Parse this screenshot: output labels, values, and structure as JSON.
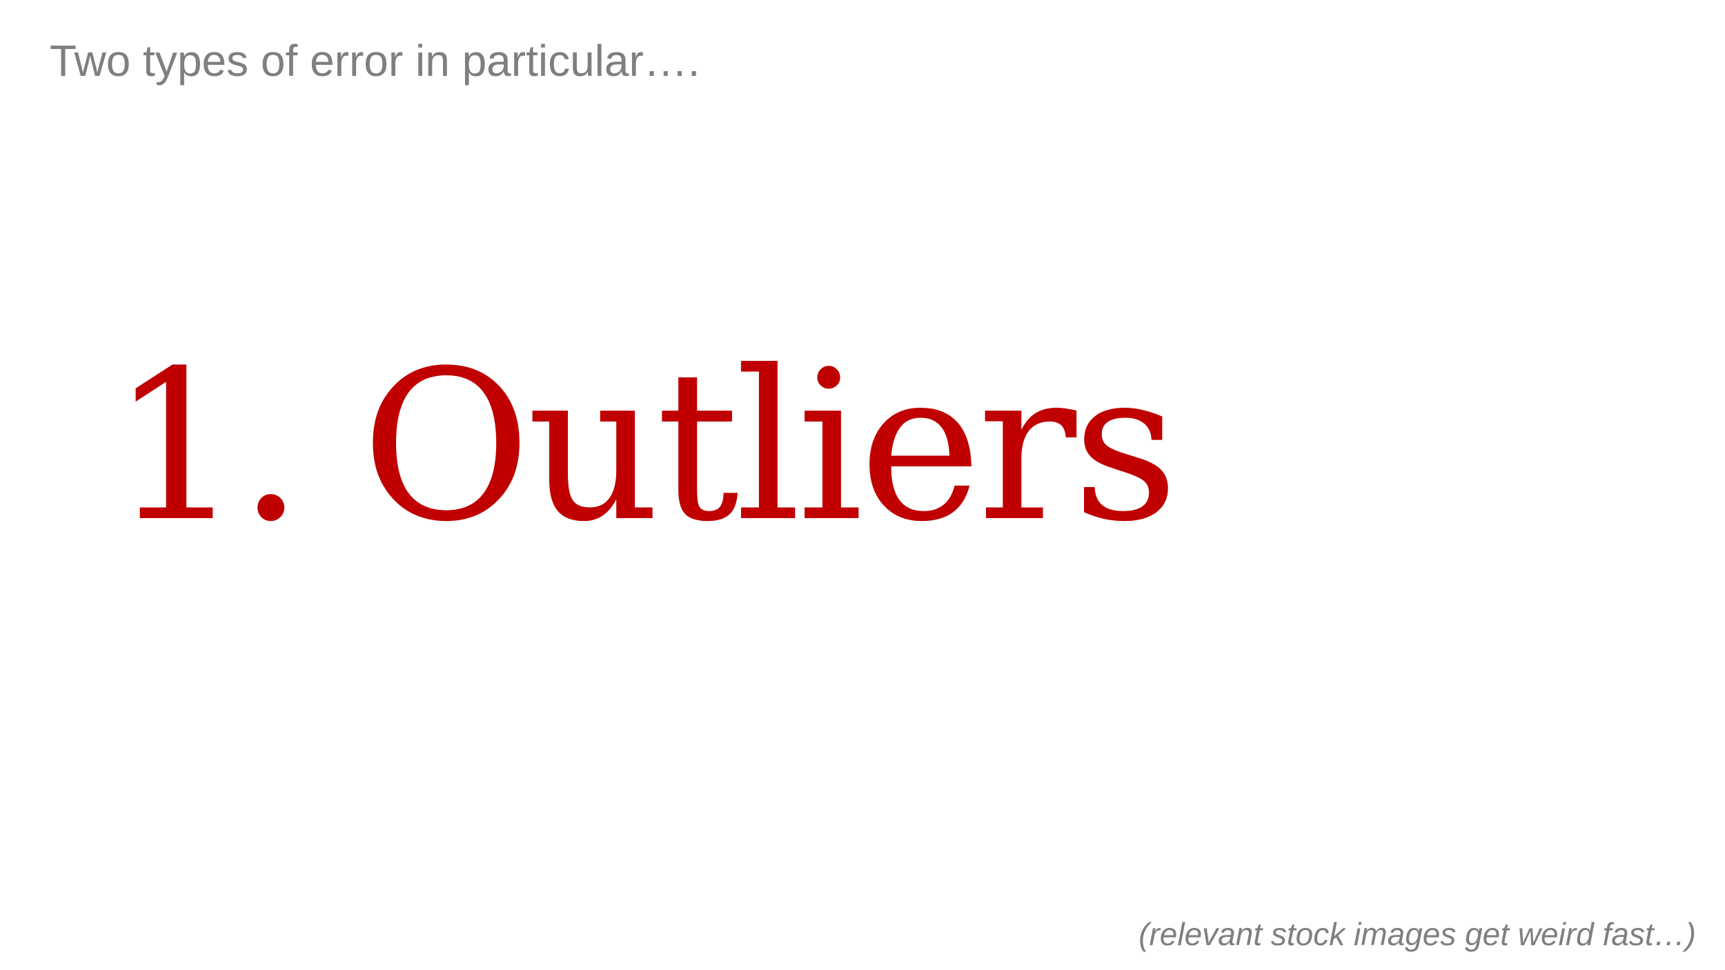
{
  "slide": {
    "heading": "Two types of error in particular….",
    "main_point": "1. Outliers",
    "caption": "(relevant stock images get weird fast…)"
  },
  "colors": {
    "background": "#ffffff",
    "heading_text": "#7f7f7f",
    "main_point_text": "#c00000",
    "caption_text": "#7f7f7f"
  }
}
